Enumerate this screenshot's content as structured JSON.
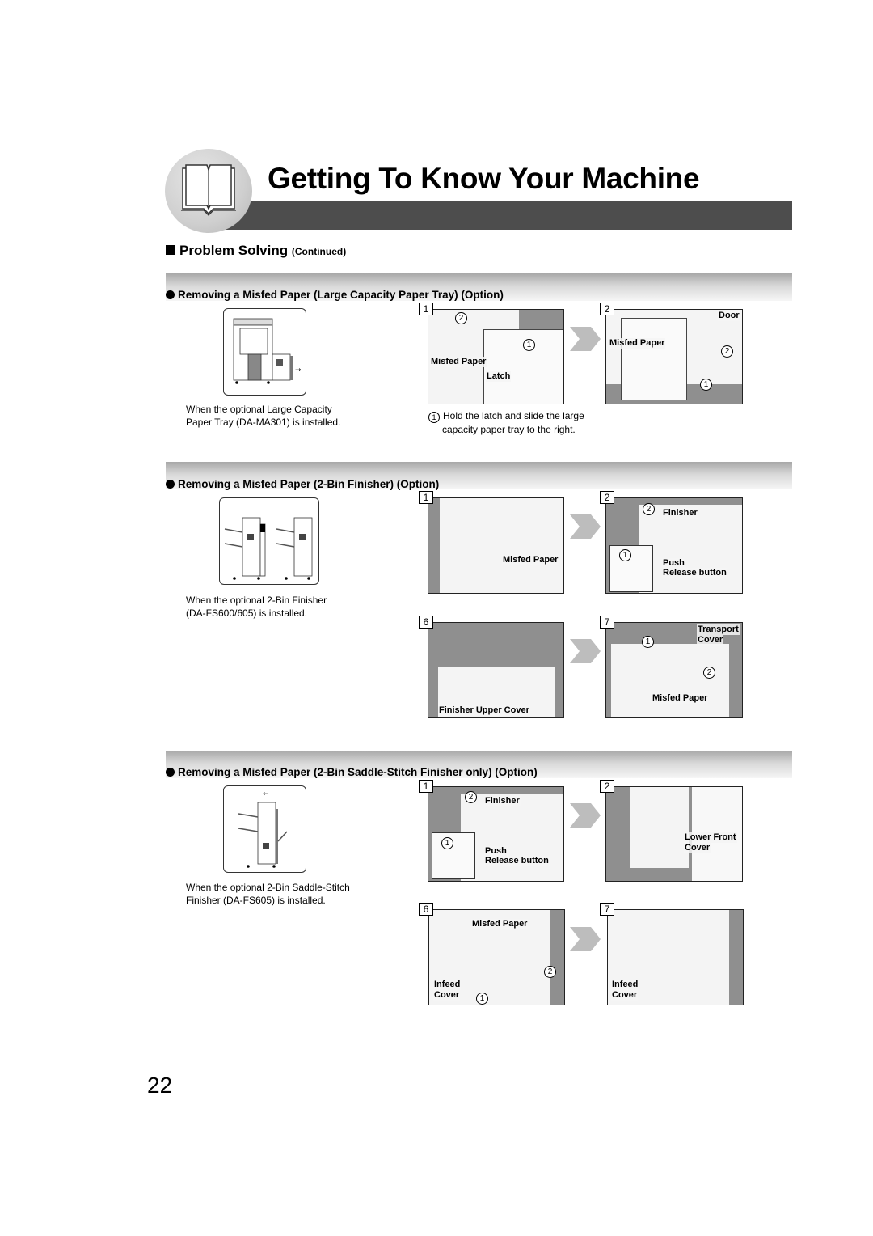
{
  "header": {
    "title": "Getting To Know Your Machine",
    "icon": "open-book-icon"
  },
  "section": {
    "title": "Problem Solving",
    "continued": "(Continued)"
  },
  "subsections": [
    {
      "title": "Removing a Misfed Paper (Large Capacity Paper Tray) (Option)",
      "caption": [
        "When the optional Large Capacity",
        "Paper Tray (DA-MA301) is installed."
      ],
      "steps": [
        {
          "num": "1",
          "labels": [
            "Misfed Paper",
            "Latch"
          ],
          "markers": [
            "2",
            "1"
          ]
        },
        {
          "num": "2",
          "labels": [
            "Door",
            "Misfed Paper"
          ],
          "markers": [
            "2",
            "1"
          ]
        }
      ],
      "note": {
        "marker": "1",
        "lines": [
          "Hold the latch and slide the large",
          "capacity paper tray to the right."
        ]
      }
    },
    {
      "title": "Removing a Misfed Paper (2-Bin Finisher) (Option)",
      "caption": [
        "When the optional 2-Bin Finisher",
        "(DA-FS600/605) is installed."
      ],
      "steps": [
        {
          "num": "1",
          "labels": [
            "Misfed Paper"
          ]
        },
        {
          "num": "2",
          "labels": [
            "Finisher",
            "Push",
            "Release button"
          ],
          "markers": [
            "2",
            "1"
          ]
        },
        {
          "num": "6",
          "labels": [
            "Finisher Upper Cover"
          ]
        },
        {
          "num": "7",
          "labels": [
            "Transport",
            "Cover",
            "Misfed Paper"
          ],
          "markers": [
            "1",
            "2"
          ]
        }
      ]
    },
    {
      "title": "Removing a Misfed Paper (2-Bin Saddle-Stitch Finisher only) (Option)",
      "caption": [
        "When the optional 2-Bin Saddle-Stitch",
        "Finisher (DA-FS605) is installed."
      ],
      "steps": [
        {
          "num": "1",
          "labels": [
            "Finisher",
            "Push",
            "Release button"
          ],
          "markers": [
            "2",
            "1"
          ]
        },
        {
          "num": "2",
          "labels": [
            "Lower Front",
            "Cover"
          ]
        },
        {
          "num": "6",
          "labels": [
            "Misfed Paper",
            "Infeed",
            "Cover"
          ],
          "markers": [
            "2",
            "1"
          ]
        },
        {
          "num": "7",
          "labels": [
            "Infeed",
            "Cover"
          ]
        }
      ]
    }
  ],
  "page_number": "22"
}
